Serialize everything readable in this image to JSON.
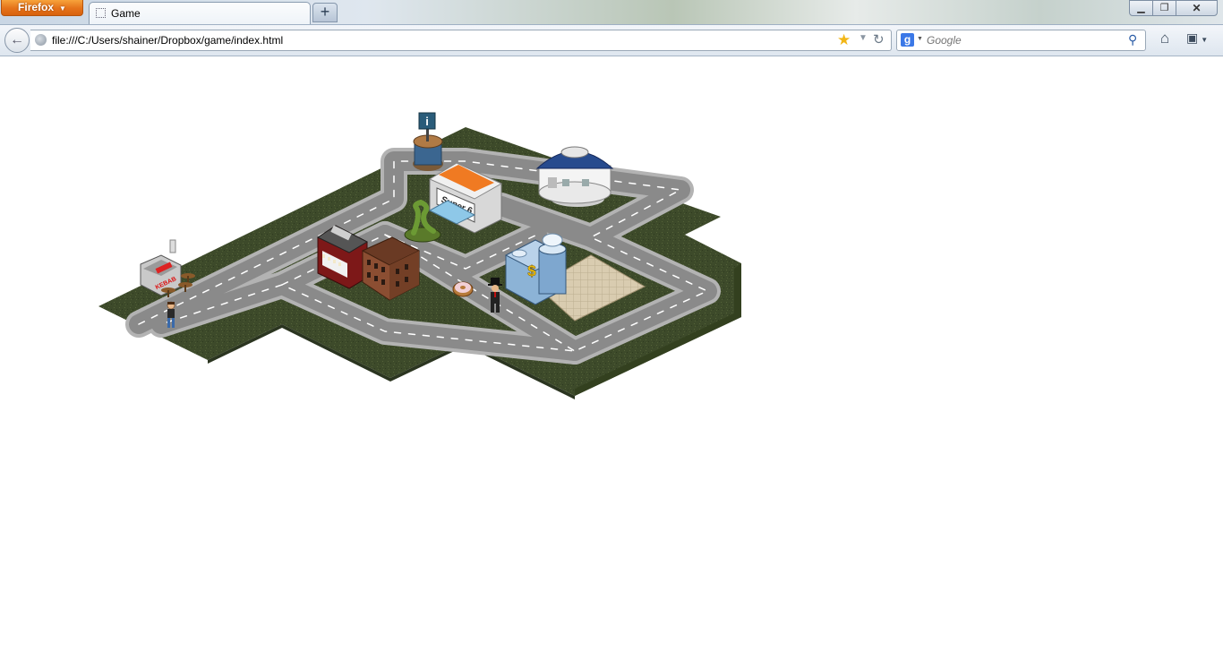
{
  "browser": {
    "menu_button": "Firefox",
    "tab_title": "Game",
    "new_tab_label": "+",
    "url": "file:///C:/Users/shainer/Dropbox/game/index.html",
    "search_placeholder": "Google",
    "search_engine_letter": "g",
    "icons": [
      "back-arrow-icon",
      "globe-icon",
      "bookmark-star-icon",
      "history-dropdown-icon",
      "reload-icon",
      "google-icon",
      "search-icon",
      "home-icon",
      "bookmarks-icon",
      "minimize-icon",
      "maximize-icon",
      "close-icon"
    ]
  },
  "game": {
    "buildings": [
      {
        "kind": "info-kiosk",
        "sign": "i"
      },
      {
        "kind": "supermarket",
        "sign": "Super 6"
      },
      {
        "kind": "dome-building"
      },
      {
        "kind": "snake-statue"
      },
      {
        "kind": "red-shop"
      },
      {
        "kind": "brick-apartment"
      },
      {
        "kind": "kebab-stand",
        "sign": "KEBAB"
      },
      {
        "kind": "bank",
        "sign": "$"
      },
      {
        "kind": "donut"
      },
      {
        "kind": "plaza"
      }
    ],
    "characters": [
      {
        "kind": "player-boy"
      },
      {
        "kind": "businessman-top-hat"
      }
    ],
    "colors": {
      "grass": "#3d4a2a",
      "road": "#8a8a8a",
      "sidewalk": "#b3b3b3",
      "lane_marking": "#ffffff"
    }
  }
}
